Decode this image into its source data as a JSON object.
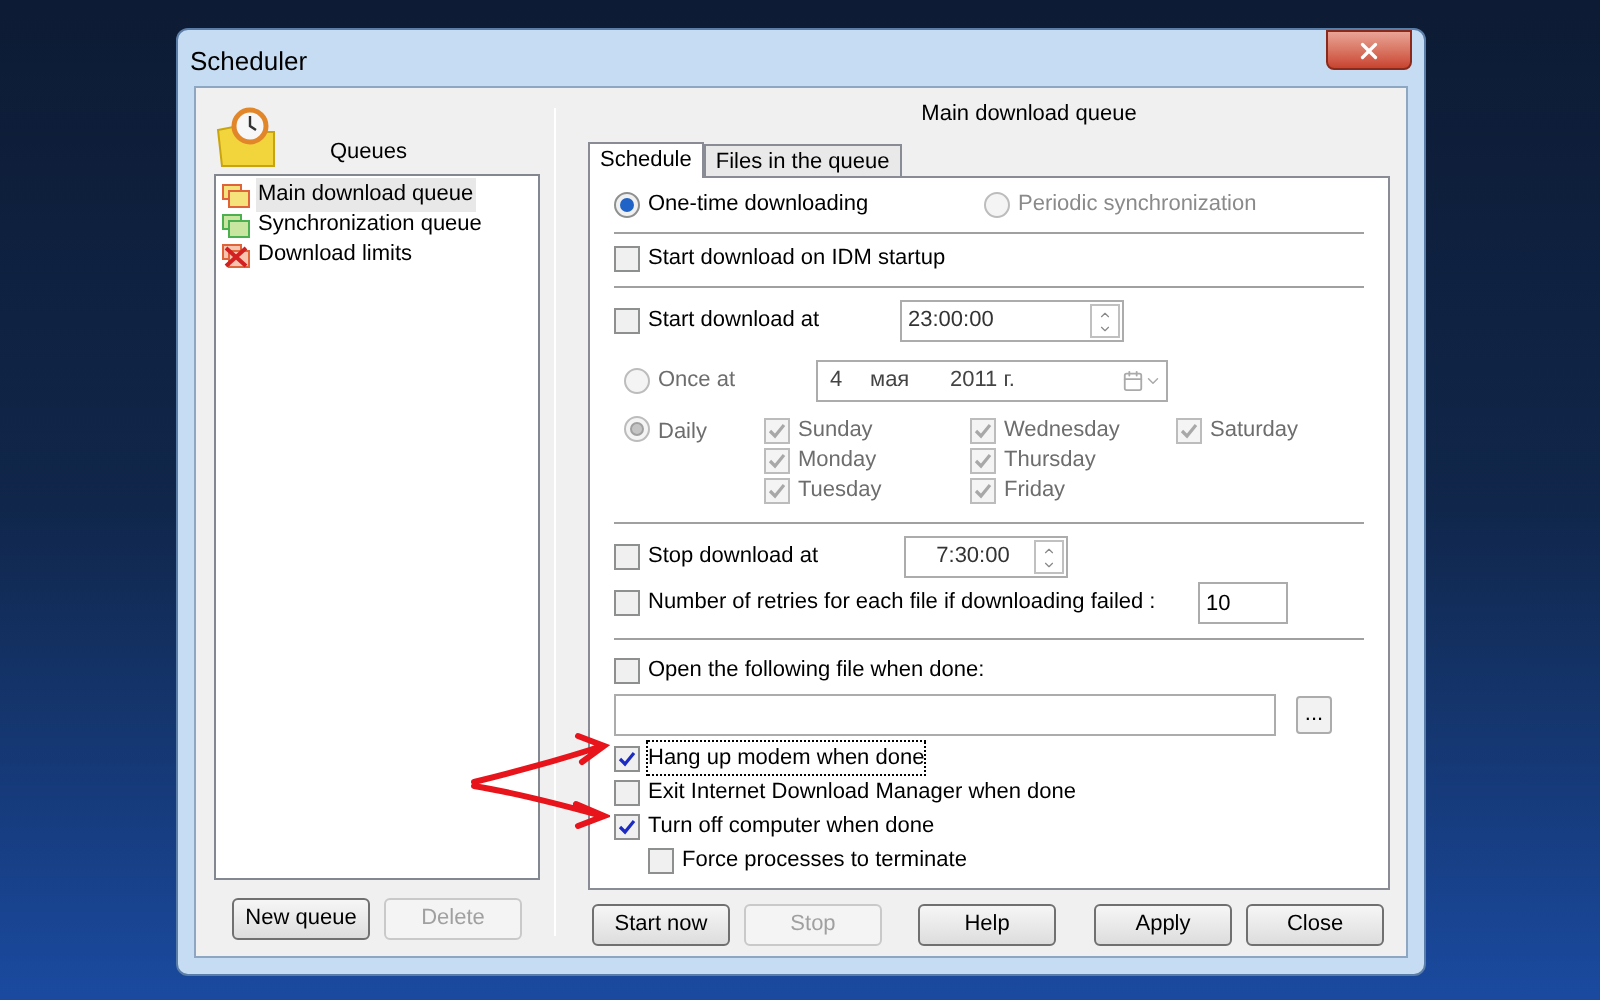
{
  "window": {
    "title": "Scheduler"
  },
  "queues": {
    "title": "Queues",
    "items": [
      {
        "label": "Main download queue",
        "selected": true,
        "kind": "main"
      },
      {
        "label": "Synchronization queue",
        "selected": false,
        "kind": "sync"
      },
      {
        "label": "Download limits",
        "selected": false,
        "kind": "limits"
      }
    ]
  },
  "left_buttons": [
    {
      "label": "New queue",
      "disabled": false
    },
    {
      "label": "Delete",
      "disabled": true
    }
  ],
  "panel": {
    "title": "Main download queue",
    "tabs": [
      {
        "label": "Schedule",
        "selected": true
      },
      {
        "label": "Files in the queue",
        "selected": false
      }
    ],
    "mode": [
      {
        "label": "One-time downloading",
        "selected": true,
        "disabled": false
      },
      {
        "label": "Periodic synchronization",
        "selected": false,
        "disabled": true
      }
    ],
    "start_on_startup": {
      "label": "Start download on IDM startup",
      "checked": false
    },
    "start_at": {
      "label": "Start download at",
      "checked": false,
      "value": "23:00:00"
    },
    "repeat": [
      {
        "label": "Once at",
        "selected": false,
        "disabled": true
      },
      {
        "label": "Daily",
        "selected": true,
        "disabled": true
      }
    ],
    "date": {
      "day": "4",
      "month": "мая",
      "year": "2011 г."
    },
    "day_columns": [
      {
        "days": [
          {
            "label": "Sunday",
            "checked": true,
            "disabled": true
          },
          {
            "label": "Monday",
            "checked": true,
            "disabled": true
          },
          {
            "label": "Tuesday",
            "checked": true,
            "disabled": true
          }
        ]
      },
      {
        "days": [
          {
            "label": "Wednesday",
            "checked": true,
            "disabled": true
          },
          {
            "label": "Thursday",
            "checked": true,
            "disabled": true
          },
          {
            "label": "Friday",
            "checked": true,
            "disabled": true
          }
        ]
      },
      {
        "days": [
          {
            "label": "Saturday",
            "checked": true,
            "disabled": true
          }
        ]
      }
    ],
    "stop_at": {
      "label": "Stop download at",
      "checked": false,
      "value": "7:30:00"
    },
    "retries": {
      "label": "Number of retries for each file if downloading failed :",
      "checked": false,
      "value": "10"
    },
    "open_file": {
      "label": "Open the following file when done:",
      "checked": false,
      "browse": "..."
    },
    "when_done": [
      {
        "label": "Hang up modem when done",
        "checked": true,
        "focused": true,
        "kind": "main"
      },
      {
        "label": "Exit Internet Download Manager when done",
        "checked": false,
        "focused": false,
        "kind": "main"
      },
      {
        "label": "Turn off computer when done",
        "checked": true,
        "focused": false,
        "kind": "main"
      },
      {
        "label": "Force processes to terminate",
        "checked": false,
        "focused": false,
        "kind": "sub"
      }
    ]
  },
  "buttons": [
    {
      "label": "Start now",
      "disabled": false
    },
    {
      "label": "Stop",
      "disabled": true
    },
    {
      "label": "Help",
      "disabled": false
    },
    {
      "label": "Apply",
      "disabled": false
    },
    {
      "label": "Close",
      "disabled": false
    }
  ]
}
